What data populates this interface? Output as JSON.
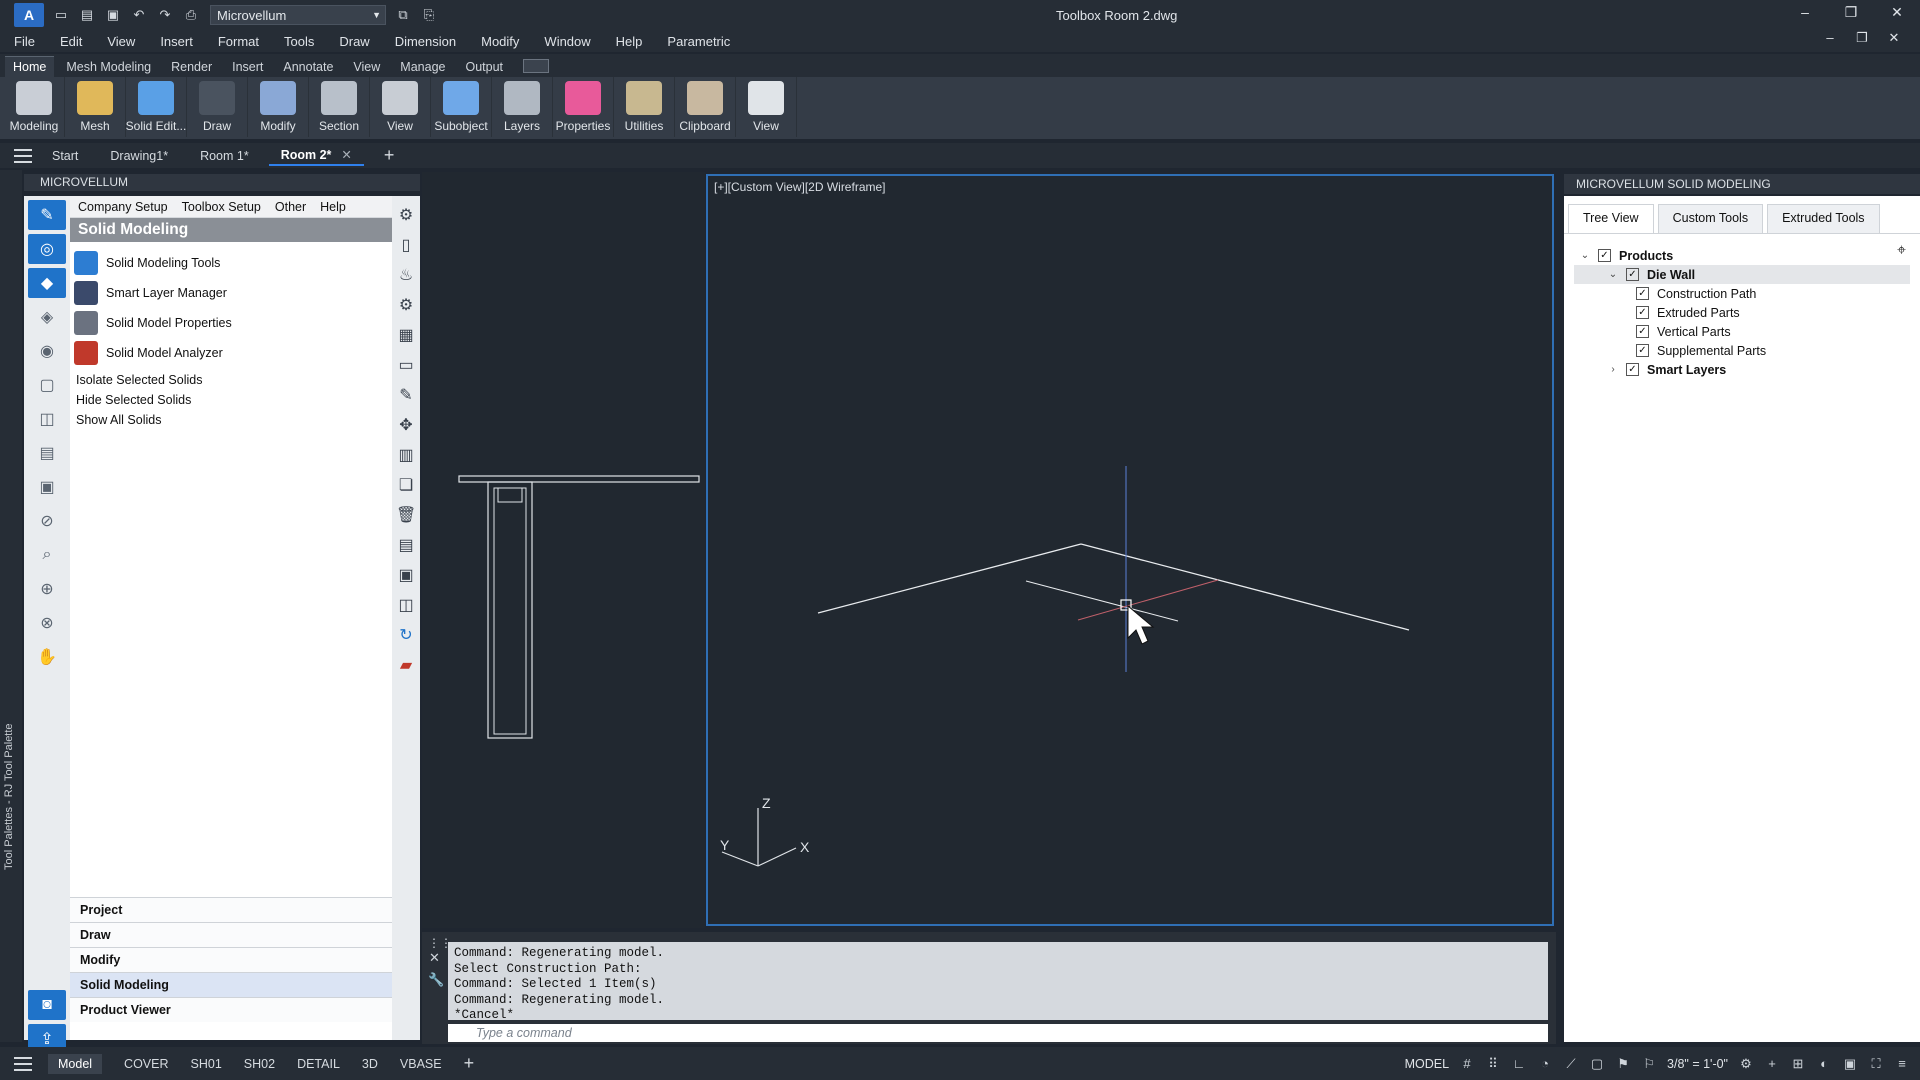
{
  "titlebar": {
    "workspace": "Microvellum",
    "title": "Toolbox    Room 2.dwg",
    "min": "–",
    "restore": "❐",
    "close": "✕"
  },
  "menu": [
    "File",
    "Edit",
    "View",
    "Insert",
    "Format",
    "Tools",
    "Draw",
    "Dimension",
    "Modify",
    "Window",
    "Help",
    "Parametric"
  ],
  "ribbon_tabs": [
    "Home",
    "Mesh Modeling",
    "Render",
    "Insert",
    "Annotate",
    "View",
    "Manage",
    "Output"
  ],
  "ribbon_buttons": [
    {
      "label": "Modeling",
      "color": "#c9ced6"
    },
    {
      "label": "Mesh",
      "color": "#e0b85a"
    },
    {
      "label": "Solid Edit...",
      "color": "#5aa0e6"
    },
    {
      "label": "Draw",
      "color": "#4a535f"
    },
    {
      "label": "Modify",
      "color": "#8aa8d6"
    },
    {
      "label": "Section",
      "color": "#b8c0ca"
    },
    {
      "label": "View",
      "color": "#c8cdd4"
    },
    {
      "label": "Subobject",
      "color": "#6fa8e8"
    },
    {
      "label": "Layers",
      "color": "#b0b8c2"
    },
    {
      "label": "Properties",
      "color": "#e85a9a"
    },
    {
      "label": "Utilities",
      "color": "#c8b890"
    },
    {
      "label": "Clipboard",
      "color": "#c8b8a0"
    },
    {
      "label": "View",
      "color": "#e0e4e8"
    }
  ],
  "doc_tabs": [
    "Start",
    "Drawing1*",
    "Room 1*",
    "Room 2*"
  ],
  "doc_tab_add": "+",
  "left_palette": {
    "strip_label": "Tool Palettes - RJ Tool Palette",
    "header": "MICROVELLUM",
    "menu": [
      "Company Setup",
      "Toolbox Setup",
      "Other",
      "Help"
    ],
    "title": "Solid Modeling",
    "tools": [
      {
        "label": "Solid Modeling Tools",
        "color": "#2d7dd2"
      },
      {
        "label": "Smart Layer Manager",
        "color": "#3b4a6b"
      },
      {
        "label": "Solid Model Properties",
        "color": "#6b7280"
      },
      {
        "label": "Solid Model Analyzer",
        "color": "#c0392b"
      }
    ],
    "actions": [
      "Isolate Selected Solids",
      "Hide Selected Solids",
      "Show All Solids"
    ],
    "sections": [
      "Project",
      "Draw",
      "Modify",
      "Solid Modeling",
      "Product Viewer"
    ]
  },
  "viewport": {
    "label": "[+][Custom View][2D Wireframe]",
    "ucs_x": "X",
    "ucs_y": "Y",
    "ucs_z": "Z"
  },
  "command": {
    "lines": [
      "Command: Regenerating model.",
      "Select Construction Path:",
      "Command: Selected 1 Item(s)",
      "Command: Regenerating model.",
      "*Cancel*"
    ],
    "placeholder": "Type a command"
  },
  "right_panel": {
    "header": "MICROVELLUM SOLID MODELING",
    "tabs": [
      "Tree View",
      "Custom Tools",
      "Extruded Tools"
    ],
    "tree": [
      {
        "label": "Products",
        "level": 0,
        "toggle": "⌄",
        "bold": true
      },
      {
        "label": "Die Wall",
        "level": 1,
        "toggle": "⌄",
        "bold": true
      },
      {
        "label": "Construction Path",
        "level": 2,
        "toggle": "",
        "bold": false
      },
      {
        "label": "Extruded Parts",
        "level": 2,
        "toggle": "",
        "bold": false
      },
      {
        "label": "Vertical Parts",
        "level": 2,
        "toggle": "",
        "bold": false
      },
      {
        "label": "Supplemental Parts",
        "level": 2,
        "toggle": "",
        "bold": false
      },
      {
        "label": "Smart Layers",
        "level": 1,
        "toggle": "›",
        "bold": true
      }
    ]
  },
  "statusbar": {
    "layout_tabs": [
      "Model",
      "COVER",
      "SH01",
      "SH02",
      "DETAIL",
      "3D",
      "VBASE"
    ],
    "mode": "MODEL",
    "scale": "3/8\" = 1'-0\""
  }
}
